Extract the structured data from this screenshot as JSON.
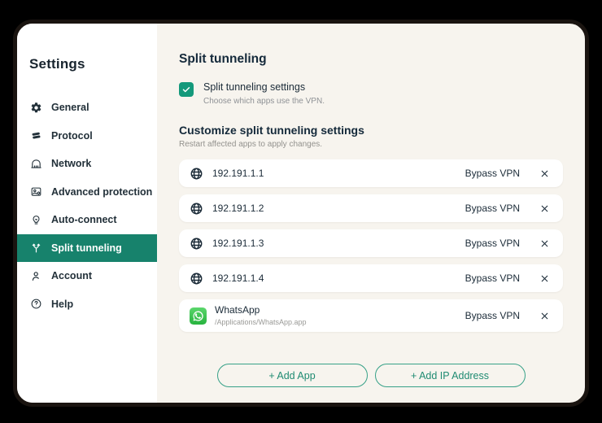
{
  "sidebar": {
    "title": "Settings",
    "items": [
      {
        "label": "General",
        "icon": "gear-icon",
        "active": false
      },
      {
        "label": "Protocol",
        "icon": "layers-icon",
        "active": false
      },
      {
        "label": "Network",
        "icon": "network-port-icon",
        "active": false
      },
      {
        "label": "Advanced protection",
        "icon": "id-badge-icon",
        "active": false
      },
      {
        "label": "Auto-connect",
        "icon": "lightbulb-icon",
        "active": false
      },
      {
        "label": "Split tunneling",
        "icon": "split-branch-icon",
        "active": true
      },
      {
        "label": "Account",
        "icon": "person-icon",
        "active": false
      },
      {
        "label": "Help",
        "icon": "help-icon",
        "active": false
      }
    ]
  },
  "main": {
    "title": "Split tunneling",
    "toggle": {
      "checked": true,
      "label": "Split tunneling settings",
      "description": "Choose which apps use the VPN."
    },
    "section": {
      "title": "Customize split tunneling settings",
      "description": "Restart affected apps to apply changes."
    },
    "rows": [
      {
        "type": "ip",
        "name": "192.191.1.1",
        "mode": "Bypass VPN",
        "icon": "globe-icon"
      },
      {
        "type": "ip",
        "name": "192.191.1.2",
        "mode": "Bypass VPN",
        "icon": "globe-icon"
      },
      {
        "type": "ip",
        "name": "192.191.1.3",
        "mode": "Bypass VPN",
        "icon": "globe-icon"
      },
      {
        "type": "ip",
        "name": "192.191.1.4",
        "mode": "Bypass VPN",
        "icon": "globe-icon"
      },
      {
        "type": "app",
        "name": "WhatsApp",
        "path": "/Applications/WhatsApp.app",
        "mode": "Bypass VPN",
        "icon": "whatsapp-icon"
      }
    ],
    "buttons": [
      {
        "label": "+ Add App"
      },
      {
        "label": "+ Add IP Address"
      }
    ]
  },
  "colors": {
    "page_background": "#000000",
    "window_border": "#1a1410",
    "sidebar_background": "#ffffff",
    "main_background": "#f7f4ee",
    "accent_teal": "#17826c",
    "checkbox_teal": "#14997b",
    "button_teal": "#1f8b72",
    "text_dark": "#1b2b38",
    "text_gray": "#8f9296",
    "whatsapp_green": "#3cc74f"
  }
}
